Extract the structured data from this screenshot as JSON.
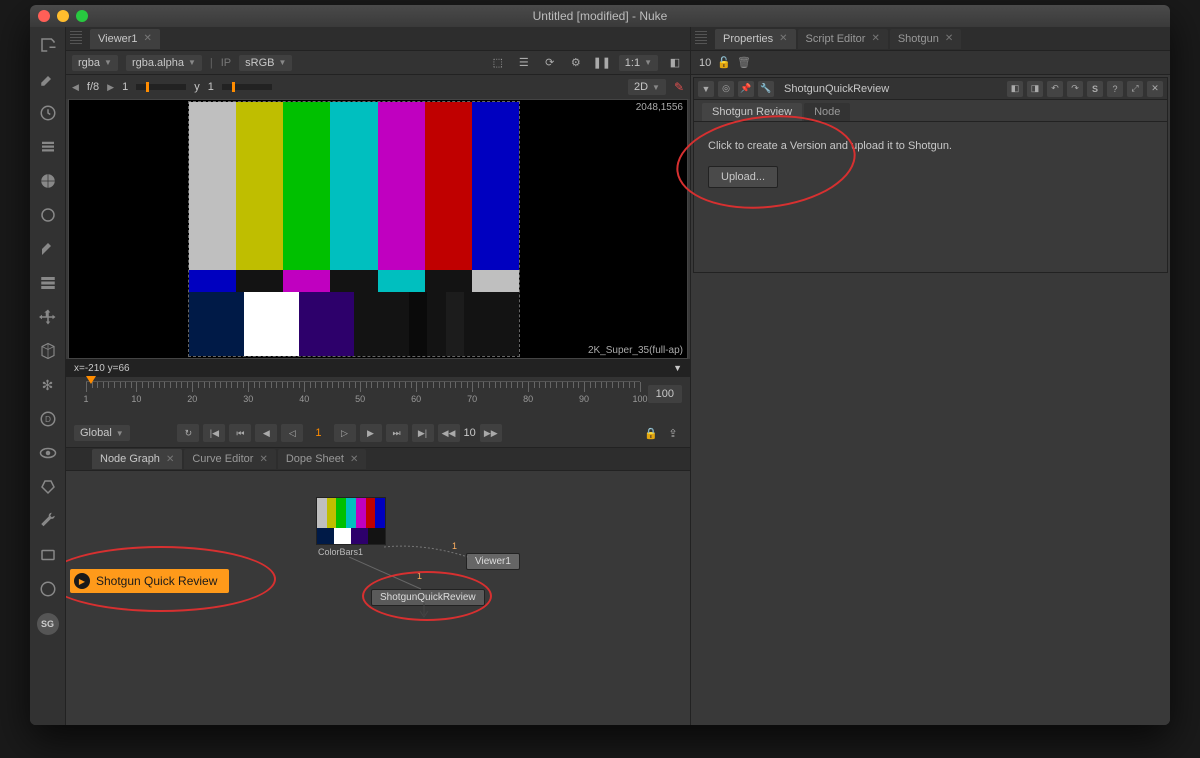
{
  "window": {
    "title": "Untitled [modified] - Nuke"
  },
  "toolbar_icons": [
    "import",
    "draw",
    "clock",
    "list",
    "pie",
    "circle",
    "arrow-dl",
    "layers",
    "move",
    "cube",
    "snow",
    "d",
    "eye",
    "tag",
    "wrench",
    "disk",
    "spiral",
    "sg"
  ],
  "viewer": {
    "tab": "Viewer1",
    "channel": "rgba",
    "subchannel": "rgba.alpha",
    "ip_label": "IP",
    "lut": "sRGB",
    "zoom": "1:1",
    "dim_label": "2D",
    "fstop_prefix": "f/8",
    "fstop_val": "1",
    "y_label": "y",
    "y_val": "1",
    "resolution": "2048,1556",
    "format": "2K_Super_35(full-ap)",
    "status": "x=-210 y=66"
  },
  "timeline": {
    "start": 1,
    "end": 100,
    "ticks": [
      1,
      10,
      20,
      30,
      40,
      50,
      60,
      70,
      80,
      90,
      100
    ],
    "frame_count": "100",
    "scope": "Global",
    "current": "1",
    "skip": "10"
  },
  "node_graph": {
    "tabs": [
      "Node Graph",
      "Curve Editor",
      "Dope Sheet"
    ],
    "sg_button": "Shotgun Quick Review",
    "nodes": {
      "colorbars": "ColorBars1",
      "viewer": "Viewer1",
      "sgqr": "ShotgunQuickReview"
    }
  },
  "properties": {
    "tabs": [
      "Properties",
      "Script Editor",
      "Shotgun"
    ],
    "count": "10",
    "panel_name": "ShotgunQuickReview",
    "sub_tabs": [
      "Shotgun Review",
      "Node"
    ],
    "help_text": "Click to create a Version and upload it to Shotgun.",
    "upload_label": "Upload...",
    "s_label": "S"
  }
}
